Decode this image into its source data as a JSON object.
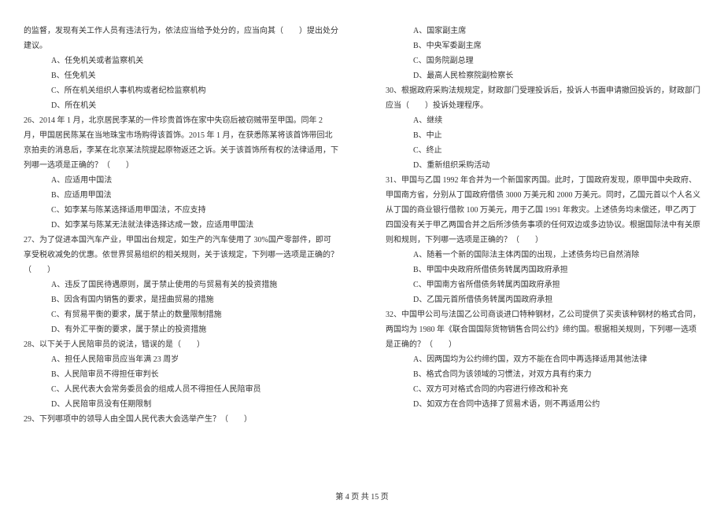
{
  "left": {
    "q25_tail": "的监督，发现有关工作人员有违法行为，依法应当给予处分的，应当向其（　　）提出处分建议。",
    "q25_opts": [
      "A、任免机关或者监察机关",
      "B、任免机关",
      "C、所在机关组织人事机构或者纪检监察机构",
      "D、所在机关"
    ],
    "q26": "26、2014 年 1 月，北京居民李某的一件珍贵首饰在家中失窃后被窃贼带至甲国。同年 2 月，甲国居民陈某在当地珠宝市场购得该首饰。2015 年 1 月，在获悉陈某将该首饰带回北京拍卖的消息后，李某在北京某法院提起原物返还之诉。关于该首饰所有权的法律适用，下列哪一选项是正确的？（　　）",
    "q26_opts": [
      "A、应适用中国法",
      "B、应适用甲国法",
      "C、如李某与陈某选择适用甲国法，不应支持",
      "D、如李某与陈某无法就法律选择达成一致，应适用甲国法"
    ],
    "q27": "27、为了促进本国汽车产业，甲国出台规定，如生产的汽车使用了 30%国产零部件，即可享受税收减免的优惠。依世界贸易组织的相关规则，关于该规定，下列哪一选项是正确的？（　　）",
    "q27_opts": [
      "A、违反了国民待遇原则，属于禁止使用的与贸易有关的投资措施",
      "B、因含有国内销售的要求，是扭曲贸易的措施",
      "C、有贸易平衡的要求，属于禁止的数量限制措施",
      "D、有外汇平衡的要求，属于禁止的投资措施"
    ],
    "q28": "28、以下关于人民陪审员的说法，错误的是（　　）",
    "q28_opts": [
      "A、担任人民陪审员应当年满 23 周岁",
      "B、人民陪审员不得担任审判长",
      "C、人民代表大会常务委员会的组成人员不得担任人民陪审员",
      "D、人民陪审员没有任期限制"
    ],
    "q29": "29、下列哪项中的领导人由全国人民代表大会选举产生？（　　）"
  },
  "right": {
    "q29_opts": [
      "A、国家副主席",
      "B、中央军委副主席",
      "C、国务院副总理",
      "D、最高人民检察院副检察长"
    ],
    "q30": "30、根据政府采购法规规定，财政部门受理投诉后，投诉人书面申请撤回投诉的，财政部门应当（　　）投诉处理程序。",
    "q30_opts": [
      "A、继续",
      "B、中止",
      "C、终止",
      "D、重新组织采购活动"
    ],
    "q31": "31、甲国与乙国 1992 年合并为一个新国家丙国。此时，丁国政府发现，原甲国中央政府、甲国南方省，分别从丁国政府借债 3000 万美元和 2000 万美元。同时，乙国元首以个人名义从丁国的商业银行借款 100 万美元，用于乙国 1991 年救灾。上述债务均未偿还，甲乙丙丁四国没有关于甲乙两国合并之后所涉债务事项的任何双边或多边协议。根据国际法中有关原则和规则，下列哪一选项是正确的？（　　）",
    "q31_opts": [
      "A、随着一个新的国际法主体丙国的出现，上述债务均已自然消除",
      "B、甲国中央政府所借债务转属丙国政府承担",
      "C、甲国南方省所借债务转属丙国政府承担",
      "D、乙国元首所借债务转属丙国政府承担"
    ],
    "q32": "32、中国甲公司与法国乙公司商谈进口特种钢材，乙公司提供了买卖该种钢材的格式合同，两国均为 1980 年《联合国国际货物销售合同公约》缔约国。根据相关规则，下列哪一选项是正确的？（　　）",
    "q32_opts": [
      "A、因两国均为公约缔约国，双方不能在合同中再选择适用其他法律",
      "B、格式合同为该领域的习惯法，对双方具有约束力",
      "C、双方可对格式合同的内容进行修改和补充",
      "D、如双方在合同中选择了贸易术语，则不再适用公约"
    ]
  },
  "footer": "第 4 页 共 15 页"
}
